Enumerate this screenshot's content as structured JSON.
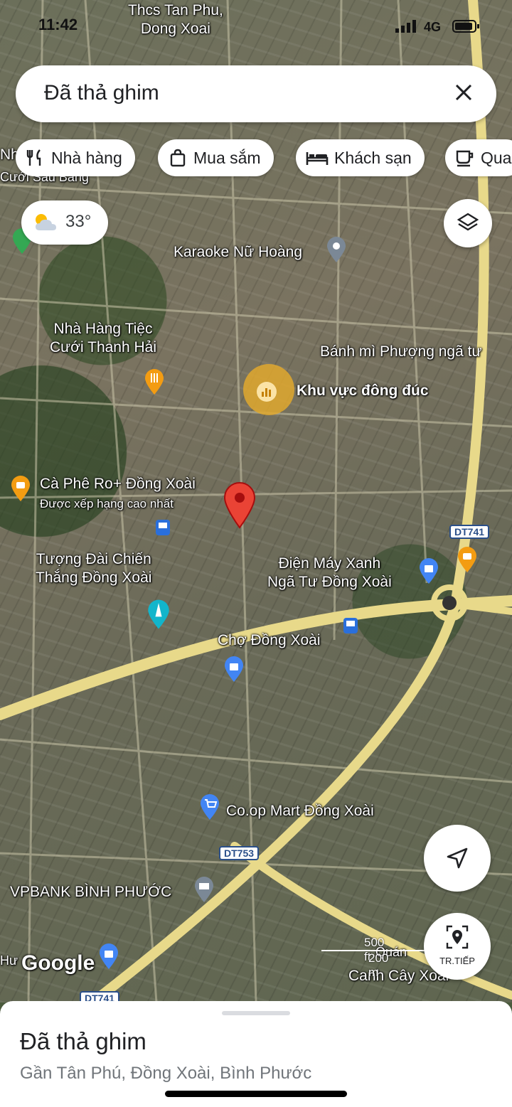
{
  "status_bar": {
    "time": "11:42",
    "network": "4G"
  },
  "search": {
    "query": "Đã thả ghim"
  },
  "chips": [
    {
      "label": "Nhà hàng",
      "icon": "fork-knife-icon"
    },
    {
      "label": "Mua sắm",
      "icon": "shopping-bag-icon"
    },
    {
      "label": "Khách sạn",
      "icon": "bed-icon"
    },
    {
      "label": "Qua",
      "icon": "coffee-cup-icon"
    }
  ],
  "weather": {
    "temp": "33°",
    "icon": "partly-cloudy-icon"
  },
  "map_labels": {
    "school": "Thcs Tan Phu,\nDong Xoai",
    "karaoke": "Karaoke Nữ Hoàng",
    "restaurant": "Nhà Hàng Tiệc\nCưới Thanh Hải",
    "banhmi": "Bánh mì Phượng ngã tư",
    "busy_area": "Khu vực đông đúc",
    "cafe": "Cà Phê Ro+ Đồng Xoài",
    "cafe_note": "Được xếp hạng cao nhất",
    "monument": "Tượng Đài Chiến\nThắng Đồng Xoài",
    "dmx": "Điện Máy Xanh\nNgã Tư Đồng Xoài",
    "market": "Chợ Đồng Xoài",
    "coop": "Co.op Mart Đồng Xoài",
    "vpbank": "VPBANK BÌNH PHƯỚC",
    "cuoi_sau": "Cưới Sau Bằng",
    "canh_cay": "Canh Cây Xoài",
    "nh_partial": "Nh",
    "hu_partial": "Hư",
    "quan": "Quán"
  },
  "road_badges": {
    "dt741_top": "DT741",
    "dt753": "DT753",
    "dt741_bottom": "DT741"
  },
  "scale": {
    "top": "500 ft",
    "bottom": "200 m"
  },
  "google_logo": "Google",
  "transit_button": "TR.TIẾP",
  "sheet": {
    "title": "Đã thả ghim",
    "subtitle": "Gần Tân Phú, Đồng Xoài, Bình Phước"
  }
}
